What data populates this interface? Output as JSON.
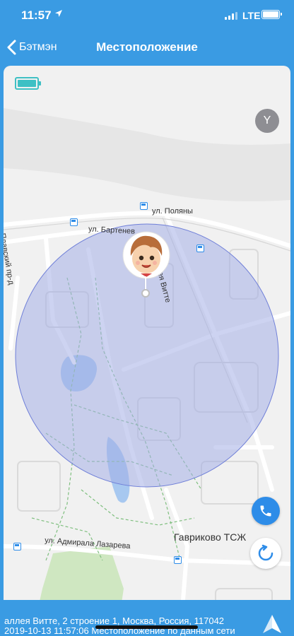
{
  "status_bar": {
    "time": "11:57",
    "network": "LTE",
    "icons": [
      "location-arrow-icon",
      "signal-icon",
      "battery-icon"
    ]
  },
  "nav": {
    "back_label": "Бэтмэн",
    "title": "Местоположение"
  },
  "map": {
    "user_chip": "Y",
    "street_labels": {
      "poliany": "ул. Поляны",
      "bartenevskaya": "ул. Бартенев",
      "vitte": "аллея Витте",
      "plavsky": "Плавский пр-д",
      "admirala": "ул. Адмирала Лазарева"
    },
    "place_label": "Гавриково ТСЖ",
    "device_battery_level": 1.0
  },
  "info": {
    "address": "аллея Витте, 2 строение 1, Москва, Россия, 117042",
    "timestamp": "2019-10-13 11:57:06 Местоположение по данным сети"
  },
  "colors": {
    "header_bg": "#3a9be3",
    "accent": "#2d8ce8",
    "battery": "#3ec0c4",
    "geofence_fill": "#a4aee6"
  }
}
